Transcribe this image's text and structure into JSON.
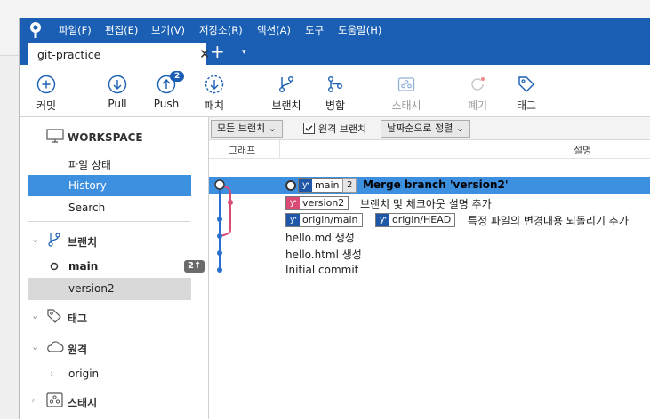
{
  "menubar": {
    "items": [
      "파일(F)",
      "편집(E)",
      "보기(V)",
      "저장소(R)",
      "액션(A)",
      "도구",
      "도움말(H)"
    ]
  },
  "tab": {
    "title": "git-practice",
    "close": "✕",
    "add": "+",
    "menu": "▾"
  },
  "toolbar": {
    "commit": "커밋",
    "pull": "Pull",
    "push": "Push",
    "push_badge": "2",
    "patch": "패치",
    "branch": "브랜치",
    "merge": "병합",
    "stash": "스태시",
    "discard": "폐기",
    "tag": "태그"
  },
  "sidebar": {
    "workspace": "WORKSPACE",
    "file_status": "파일 상태",
    "history": "History",
    "search": "Search",
    "branches_header": "브랜치",
    "branch_main": "main",
    "branch_main_ahead": "2↑",
    "branch_version2": "version2",
    "tags_header": "태그",
    "remotes_header": "원격",
    "remote_origin": "origin",
    "stash_header": "스태시"
  },
  "filterbar": {
    "branch_filter": "모든 브랜치",
    "remote_branches": "원격 브랜치",
    "sort": "날짜순으로 정렬"
  },
  "columns": {
    "graph": "그래프",
    "description": "설명"
  },
  "commits": [
    {
      "refs": [
        "main"
      ],
      "count": "2",
      "message": "Merge branch 'version2'"
    },
    {
      "refs": [
        "version2"
      ],
      "message": "브랜치 및 체크아웃 설명 추가"
    },
    {
      "refs": [
        "origin/main",
        "origin/HEAD"
      ],
      "message": "특정 파일의 변경내용 되돌리기 추가"
    },
    {
      "message": "hello.md 생성"
    },
    {
      "message": "hello.html 생성"
    },
    {
      "message": "Initial commit"
    }
  ],
  "colors": {
    "accent": "#1a5fb4",
    "selection": "#3d8fe0",
    "branch_pink": "#d94b73",
    "graph_blue": "#2a6fd0"
  }
}
